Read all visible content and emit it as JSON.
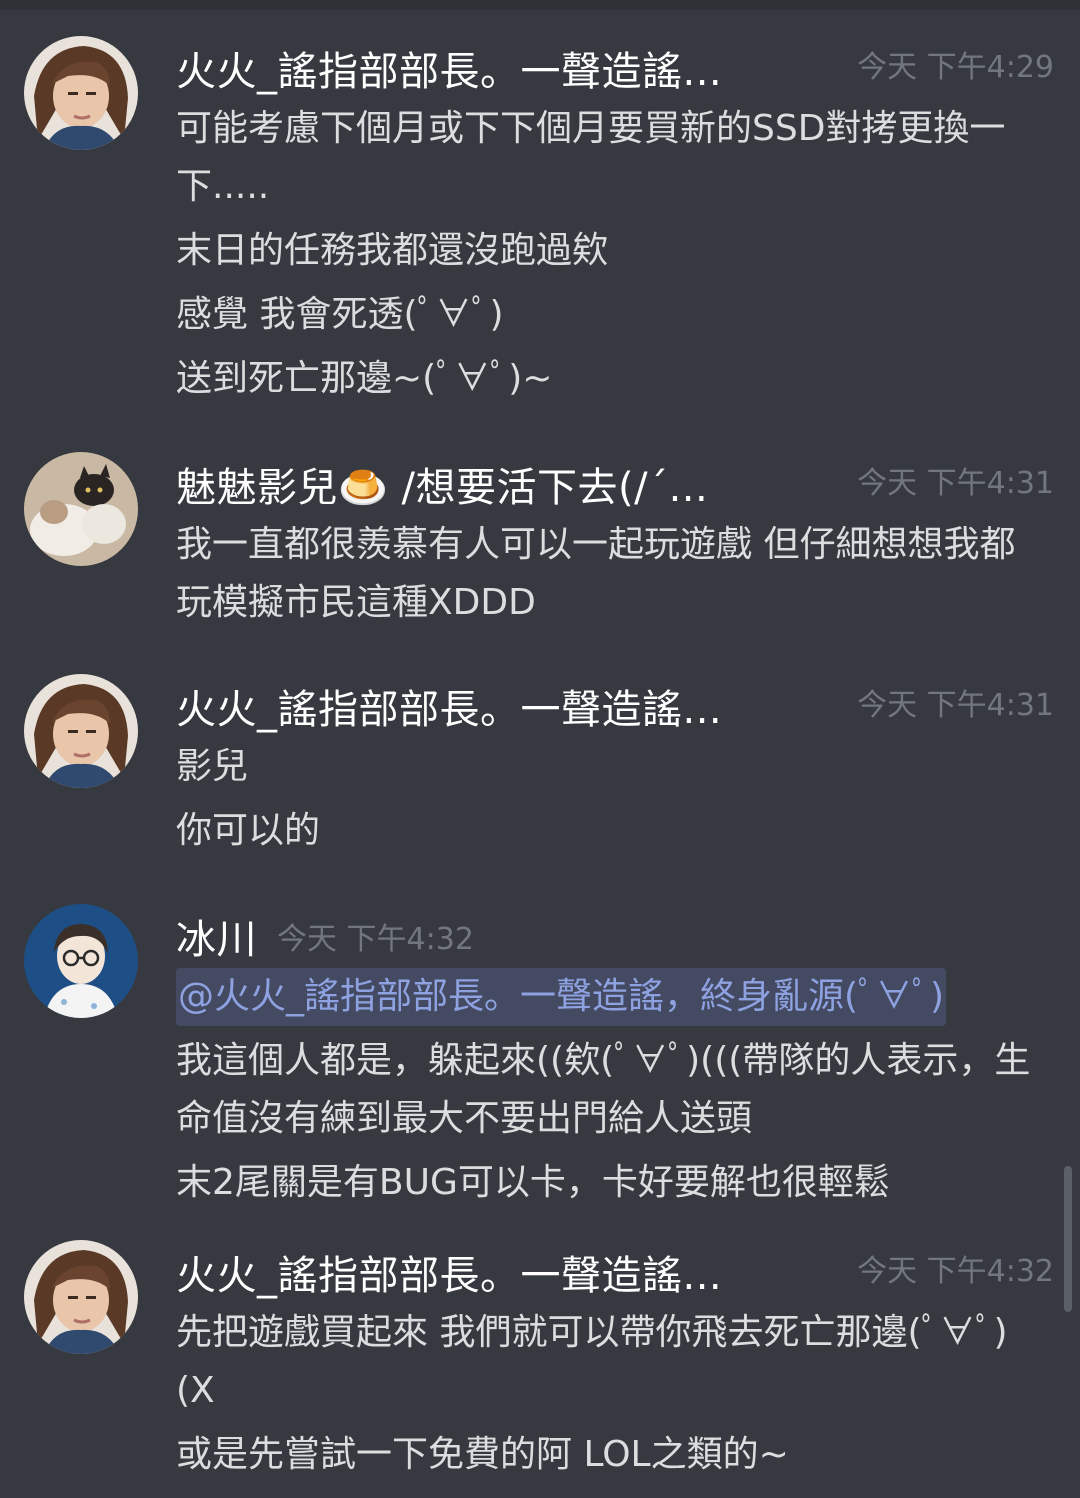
{
  "colors": {
    "background": "#36393f",
    "username": "#ffffff",
    "message_text": "#dcddde",
    "timestamp": "#72767d",
    "mention_text": "#8ea1e1",
    "mention_bg": "#3e4766"
  },
  "messages": [
    {
      "username": "火火_謠指部部長。一聲造謠...",
      "timestamp": "今天 下午4:29",
      "avatar_icon": "user-avatar-woman-icon",
      "lines": [
        "可能考慮下個月或下下個月要買新的SSD對拷更換一下.....",
        "末日的任務我都還沒跑過欸",
        "感覺 我會死透(ﾟ∀ﾟ)",
        "送到死亡那邊~(ﾟ∀ﾟ)~"
      ]
    },
    {
      "username": "魅魅影兒🍮 /想要活下去(/´...",
      "timestamp": "今天 下午4:31",
      "avatar_icon": "user-avatar-cats-icon",
      "lines": [
        "我一直都很羨慕有人可以一起玩遊戲 但仔細想想我都玩模擬市民這種XDDD"
      ]
    },
    {
      "username": "火火_謠指部部長。一聲造謠...",
      "timestamp": "今天 下午4:31",
      "avatar_icon": "user-avatar-woman-icon",
      "lines": [
        "影兒",
        "你可以的"
      ]
    },
    {
      "username": "冰川",
      "timestamp": "今天 下午4:32",
      "avatar_icon": "user-avatar-cartoon-glasses-icon",
      "mention": "@火火_謠指部部長。一聲造謠，終身亂源(ﾟ∀ﾟ)",
      "lines": [
        "我這個人都是，躲起來((欸(ﾟ∀ﾟ)(((帶隊的人表示，生命值沒有練到最大不要出門給人送頭",
        "末2尾關是有BUG可以卡，卡好要解也很輕鬆"
      ]
    },
    {
      "username": "火火_謠指部部長。一聲造謠...",
      "timestamp": "今天 下午4:32",
      "avatar_icon": "user-avatar-woman-icon",
      "lines": [
        "先把遊戲買起來 我們就可以帶你飛去死亡那邊(ﾟ∀ﾟ)(X",
        "或是先嘗試一下免費的阿 LOL之類的~"
      ]
    }
  ]
}
